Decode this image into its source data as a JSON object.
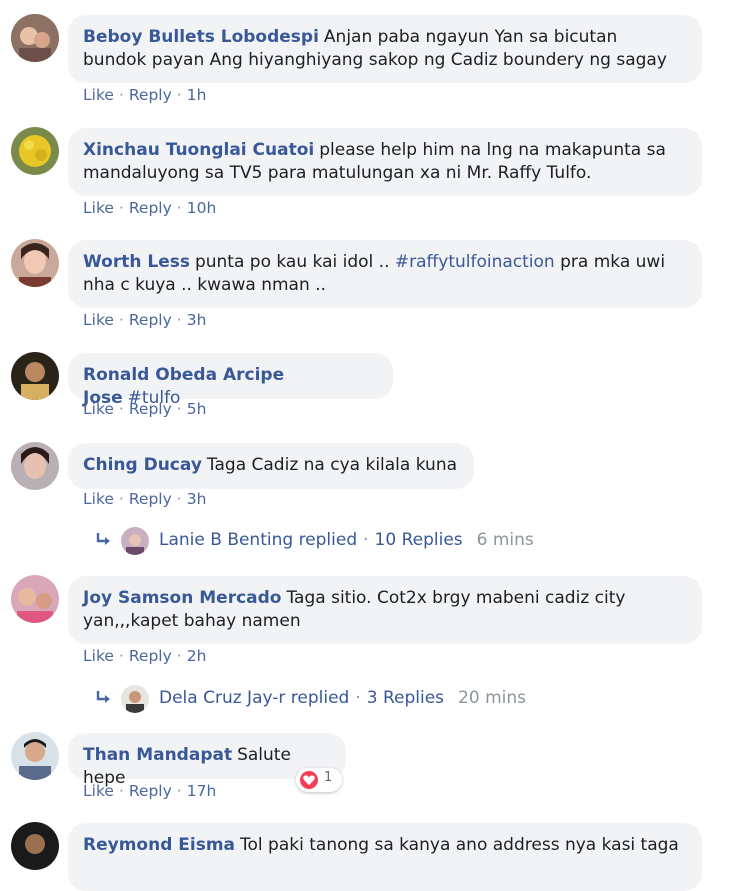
{
  "comments": [
    {
      "name": "Beboy Bullets Lobodespi",
      "text": "Anjan paba ngayun Yan sa bicutan bundok payan Ang hiyanghiyang sakop ng Cadiz boundery ng sagay",
      "time": "1h"
    },
    {
      "name": "Xinchau Tuonglai Cuatoi",
      "text": "please help him na lng na makapunta sa mandaluyong sa TV5 para matulungan xa ni Mr. Raffy Tulfo.",
      "time": "10h"
    },
    {
      "name": "Worth Less",
      "text": "punta po kau kai idol .. ",
      "hashtag": "#raffytulfoinaction",
      "text_after": " pra mka uwi nha c kuya .. kwawa nman ..",
      "time": "3h"
    },
    {
      "name": "Ronald Obeda Arcipe Jose",
      "hashtag": "#tulfo",
      "time": "5h"
    },
    {
      "name": "Ching Ducay",
      "text": "Taga Cadiz na cya kilala kuna",
      "time": "3h",
      "reply_summary": {
        "name": "Lanie B Benting replied",
        "count": "10 Replies",
        "time": "6 mins"
      }
    },
    {
      "name": "Joy Samson Mercado",
      "text": "Taga sitio. Cot2x brgy mabeni cadiz city yan,,,kapet bahay namen",
      "time": "2h",
      "reply_summary": {
        "name": "Dela Cruz Jay-r replied",
        "count": "3 Replies",
        "time": "20 mins"
      }
    },
    {
      "name": "Than Mandapat",
      "text": "Salute hepe",
      "time": "17h",
      "reaction_count": "1"
    },
    {
      "name": "Reymond Eisma",
      "text": "Tol paki tanong sa kanya ano address nya kasi taga"
    }
  ],
  "labels": {
    "like": "Like",
    "reply": "Reply",
    "sep": "·"
  },
  "colors": {
    "name": "#385898",
    "bubble": "#f2f3f5",
    "heart": "#f33e58"
  }
}
